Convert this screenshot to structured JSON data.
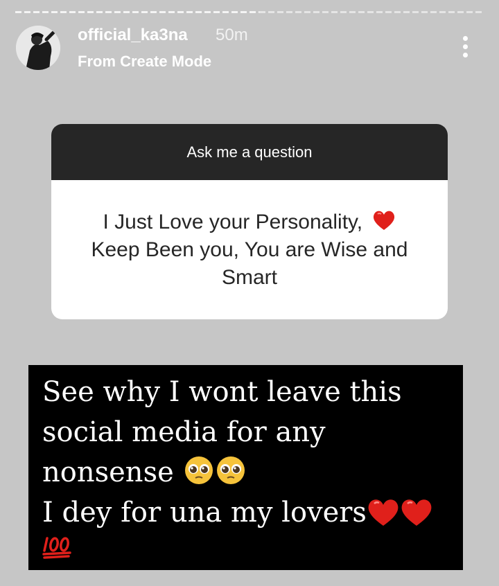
{
  "story": {
    "progress_fraction": 0.52,
    "username": "official_ka3na",
    "time": "50m",
    "subtitle": "From Create Mode"
  },
  "question_sticker": {
    "title": "Ask me a question",
    "answer": "I Just Love your Personality, ",
    "answer_line2": "Keep Been you, You are Wise and Smart",
    "heart_emoji": "red-heart"
  },
  "caption": {
    "line1": "See why I wont leave this",
    "line2": "social media for any",
    "line3": "nonsense",
    "line4": "I dey for una my lovers",
    "emojis": [
      "pleading-face",
      "pleading-face",
      "red-heart",
      "red-heart",
      "hundred-points"
    ]
  },
  "colors": {
    "background": "#c6c6c6",
    "sticker_header": "#262626",
    "heart": "#e0201b",
    "caption_bg": "#000000"
  }
}
